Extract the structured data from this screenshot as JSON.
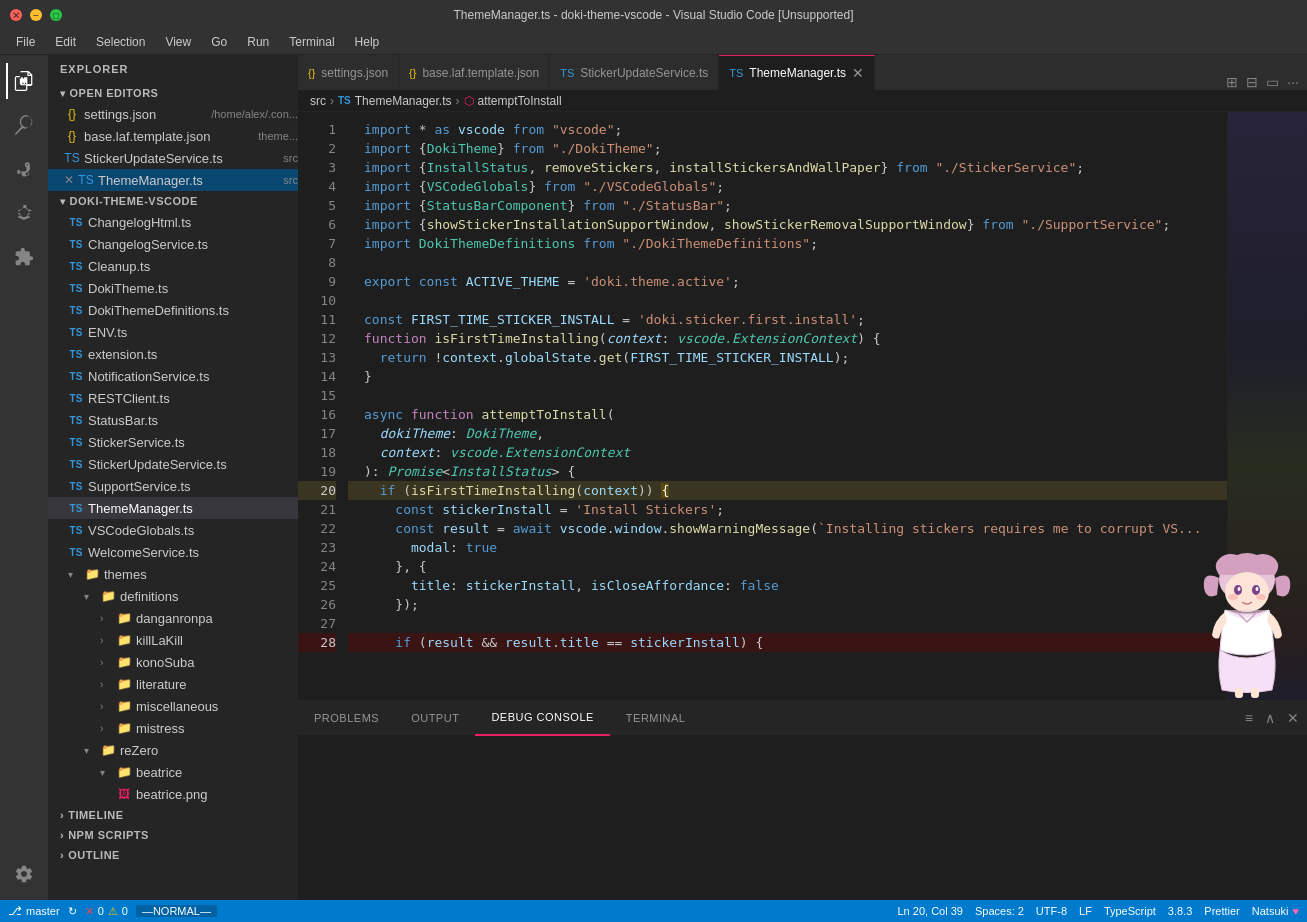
{
  "titleBar": {
    "title": "ThemeManager.ts - doki-theme-vscode - Visual Studio Code [Unsupported]"
  },
  "menuBar": {
    "items": [
      "File",
      "Edit",
      "Selection",
      "View",
      "Go",
      "Run",
      "Terminal",
      "Help"
    ]
  },
  "sidebar": {
    "header": "Explorer",
    "openEditors": {
      "label": "Open Editors",
      "items": [
        {
          "icon": "json",
          "name": "settings.json",
          "path": "/home/alex/.con..."
        },
        {
          "icon": "json",
          "name": "base.laf.template.json",
          "path": "theme..."
        },
        {
          "icon": "ts",
          "name": "StickerUpdateService.ts",
          "path": "src"
        },
        {
          "icon": "ts",
          "name": "ThemeManager.ts",
          "path": "src",
          "active": true
        }
      ]
    },
    "project": {
      "label": "DOKI-THEME-VSCODE",
      "files": [
        {
          "indent": 1,
          "icon": "ts",
          "name": "ChangelogHtml.ts"
        },
        {
          "indent": 1,
          "icon": "ts",
          "name": "ChangelogService.ts"
        },
        {
          "indent": 1,
          "icon": "ts",
          "name": "Cleanup.ts"
        },
        {
          "indent": 1,
          "icon": "ts",
          "name": "DokiTheme.ts"
        },
        {
          "indent": 1,
          "icon": "ts",
          "name": "DokiThemeDefinitions.ts"
        },
        {
          "indent": 1,
          "icon": "ts",
          "name": "ENV.ts"
        },
        {
          "indent": 1,
          "icon": "ts",
          "name": "extension.ts"
        },
        {
          "indent": 1,
          "icon": "ts",
          "name": "NotificationService.ts"
        },
        {
          "indent": 1,
          "icon": "ts",
          "name": "RESTClient.ts"
        },
        {
          "indent": 1,
          "icon": "ts",
          "name": "StatusBar.ts"
        },
        {
          "indent": 1,
          "icon": "ts",
          "name": "StickerService.ts"
        },
        {
          "indent": 1,
          "icon": "ts",
          "name": "StickerUpdateService.ts"
        },
        {
          "indent": 1,
          "icon": "ts",
          "name": "SupportService.ts"
        },
        {
          "indent": 1,
          "icon": "ts",
          "name": "ThemeManager.ts",
          "active": true
        },
        {
          "indent": 1,
          "icon": "ts",
          "name": "VSCodeGlobals.ts"
        },
        {
          "indent": 1,
          "icon": "ts",
          "name": "WelcomeService.ts"
        }
      ],
      "themes": {
        "label": "themes",
        "definitions": {
          "label": "definitions",
          "folders": [
            "danganronpa",
            "killLaKill",
            "konoSuba",
            "literature",
            "miscellaneous",
            "mistress"
          ]
        },
        "reZero": {
          "label": "reZero",
          "beatrice": {
            "label": "beatrice",
            "files": [
              "beatrice.png"
            ]
          }
        }
      }
    }
  },
  "tabs": [
    {
      "icon": "json",
      "name": "settings.json",
      "active": false
    },
    {
      "icon": "json",
      "name": "base.laf.template.json",
      "active": false
    },
    {
      "icon": "ts",
      "name": "StickerUpdateService.ts",
      "active": false
    },
    {
      "icon": "ts",
      "name": "ThemeManager.ts",
      "active": true
    }
  ],
  "breadcrumb": {
    "parts": [
      "src",
      "ThemeManager.ts",
      "attemptToInstall"
    ]
  },
  "code": {
    "lines": [
      {
        "num": 1,
        "content": "import * as vscode from \"vscode\";"
      },
      {
        "num": 2,
        "content": "import {DokiTheme} from \"./DokiTheme\";"
      },
      {
        "num": 3,
        "content": "import {InstallStatus, removeStickers, installStickersAndWallPaper} from \"./StickerService\";"
      },
      {
        "num": 4,
        "content": "import {VSCodeGlobals} from \"./VSCodeGlobals\";"
      },
      {
        "num": 5,
        "content": "import {StatusBarComponent} from \"./StatusBar\";"
      },
      {
        "num": 6,
        "content": "import {showStickerInstallationSupportWindow, showStickerRemovalSupportWindow} from \"./SupportService\";"
      },
      {
        "num": 7,
        "content": "import DokiThemeDefinitions from \"./DokiThemeDefinitions\";"
      },
      {
        "num": 8,
        "content": ""
      },
      {
        "num": 9,
        "content": "export const ACTIVE_THEME = 'doki.theme.active';"
      },
      {
        "num": 10,
        "content": ""
      },
      {
        "num": 11,
        "content": "const FIRST_TIME_STICKER_INSTALL = 'doki.sticker.first.install';"
      },
      {
        "num": 12,
        "content": "function isFirstTimeInstalling(context: vscode.ExtensionContext) {"
      },
      {
        "num": 13,
        "content": "  return !context.globalState.get(FIRST_TIME_STICKER_INSTALL);"
      },
      {
        "num": 14,
        "content": "}"
      },
      {
        "num": 15,
        "content": ""
      },
      {
        "num": 16,
        "content": "async function attemptToInstall("
      },
      {
        "num": 17,
        "content": "  dokiTheme: DokiTheme,"
      },
      {
        "num": 18,
        "content": "  context: vscode.ExtensionContext"
      },
      {
        "num": 19,
        "content": "): Promise<InstallStatus> {"
      },
      {
        "num": 20,
        "content": "  if (isFirstTimeInstalling(context)) {",
        "highlighted": true
      },
      {
        "num": 21,
        "content": "    const stickerInstall = 'Install Stickers';"
      },
      {
        "num": 22,
        "content": "    const result = await vscode.window.showWarningMessage(`Installing stickers requires me to corrupt VS..."
      },
      {
        "num": 23,
        "content": "      modal: true"
      },
      {
        "num": 24,
        "content": "    }, {"
      },
      {
        "num": 25,
        "content": "      title: stickerInstall, isCloseAffordance: false"
      },
      {
        "num": 26,
        "content": "    });"
      },
      {
        "num": 27,
        "content": ""
      },
      {
        "num": 28,
        "content": "    if (result && result.title == stickerInstall) {",
        "error": true
      }
    ]
  },
  "panel": {
    "tabs": [
      "PROBLEMS",
      "OUTPUT",
      "DEBUG CONSOLE",
      "TERMINAL"
    ],
    "activeTab": "DEBUG CONSOLE"
  },
  "statusBar": {
    "branch": "master",
    "sync": "⟳",
    "errors": "0",
    "warnings": "0",
    "mode": "—NORMAL—",
    "position": "Ln 20, Col 39",
    "spaces": "Spaces: 2",
    "encoding": "UTF-8",
    "lineEnding": "LF",
    "language": "TypeScript",
    "version": "3.8.3",
    "formatter": "Prettier",
    "user": "Natsuki",
    "heart": "♥"
  }
}
